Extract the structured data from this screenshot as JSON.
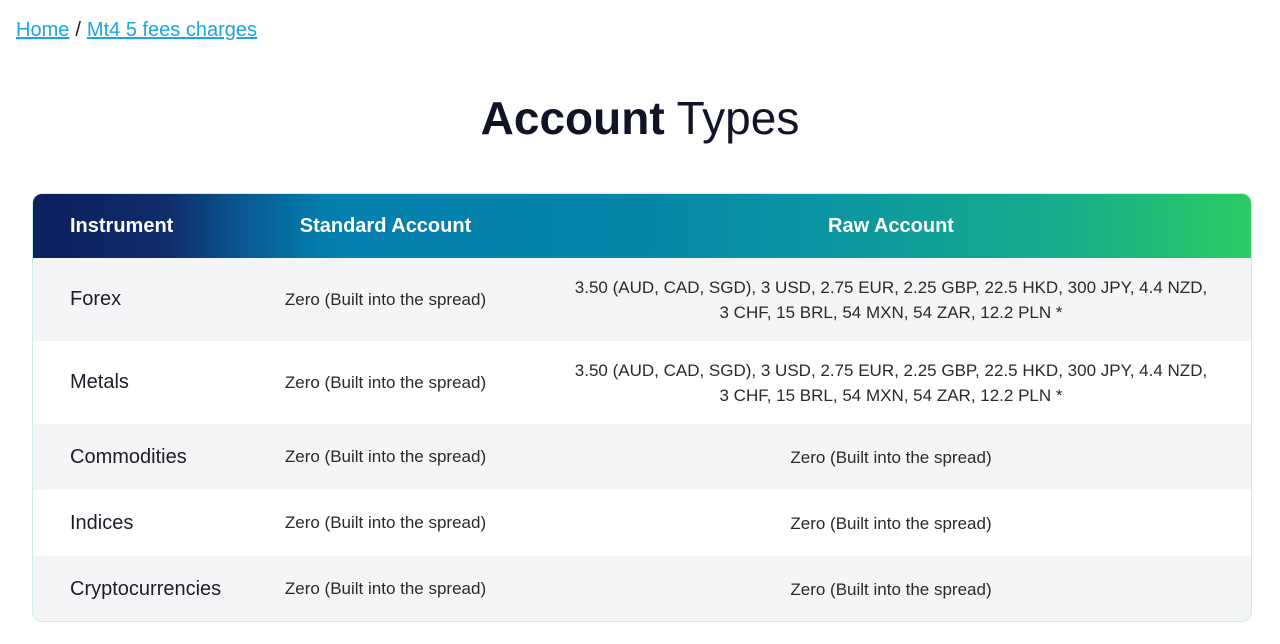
{
  "breadcrumb": {
    "home": "Home",
    "separator": "/",
    "current": "Mt4 5 fees charges"
  },
  "title": {
    "bold": "Account",
    "regular": "Types"
  },
  "table": {
    "headers": {
      "instrument": "Instrument",
      "standard": "Standard Account",
      "raw": "Raw Account"
    },
    "rows": [
      {
        "instrument": "Forex",
        "standard": "Zero (Built into the spread)",
        "raw_line1": "3.50 (AUD, CAD, SGD), 3 USD, 2.75 EUR, 2.25 GBP, 22.5 HKD, 300 JPY, 4.4 NZD,",
        "raw_line2": "3 CHF, 15 BRL, 54 MXN, 54 ZAR, 12.2 PLN *"
      },
      {
        "instrument": "Metals",
        "standard": "Zero (Built into the spread)",
        "raw_line1": "3.50 (AUD, CAD, SGD), 3 USD, 2.75 EUR, 2.25 GBP, 22.5 HKD, 300 JPY, 4.4 NZD,",
        "raw_line2": "3 CHF, 15 BRL, 54 MXN, 54 ZAR, 12.2 PLN *"
      },
      {
        "instrument": "Commodities",
        "standard": "Zero (Built into the spread)",
        "raw_line1": "Zero (Built into the spread)"
      },
      {
        "instrument": "Indices",
        "standard": "Zero (Built into the spread)",
        "raw_line1": "Zero (Built into the spread)"
      },
      {
        "instrument": "Cryptocurrencies",
        "standard": "Zero (Built into the spread)",
        "raw_line1": "Zero (Built into the spread)"
      }
    ]
  },
  "colors": {
    "link": "#1aa6e0",
    "header_gradient_start": "#0d1f5e",
    "header_gradient_mid": "#037fae",
    "header_gradient_end": "#2bcc63",
    "row_shade": "#f3f5f7"
  }
}
